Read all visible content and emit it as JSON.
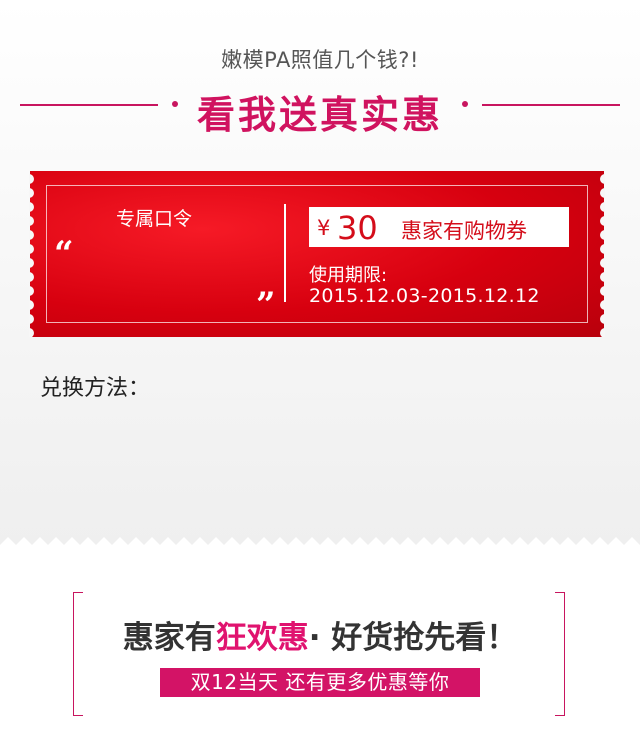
{
  "header": {
    "subtitle": "嫩模PA照值几个钱?!",
    "headline": "看我送真实惠",
    "accent_color": "#c8155f"
  },
  "coupon": {
    "code_label": "专属口令",
    "open_quote": "“",
    "close_quote": "”",
    "currency": "¥",
    "amount": "30",
    "coupon_name": "惠家有购物券",
    "validity_label": "使用期限:",
    "validity_dates": "2015.12.03-2015.12.12",
    "color": "#d7000f"
  },
  "method": {
    "label": "兑换方法："
  },
  "promo": {
    "title_prefix": "惠家有",
    "title_highlight": "狂欢惠",
    "title_suffix": "· 好货抢先看！",
    "banner": "双12当天 还有更多优惠等你",
    "highlight_color": "#e0136f"
  }
}
